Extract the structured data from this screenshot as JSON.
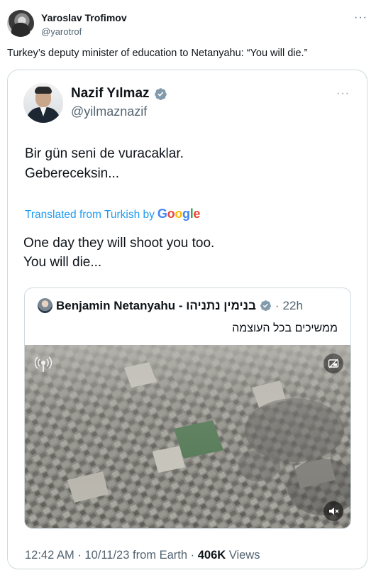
{
  "outer_tweet": {
    "author_name": "Yaroslav Trofimov",
    "author_handle": "@yarotrof",
    "more_label": "···",
    "text": "Turkey’s deputy minister of education to Netanyahu: “You will die.”"
  },
  "quoted_tweet": {
    "author_name": "Nazif Yılmaz",
    "author_handle": "@yilmaznazif",
    "more_label": "···",
    "original_text": "Bir gün seni de vuracaklar.\nGebereceksin...",
    "translated_label": "Translated from Turkish by",
    "translator": "Google",
    "translated_text": "One day they will shoot you too.\nYou will die...",
    "footer_time": "12:42 AM",
    "footer_date": "10/11/23",
    "footer_source": "from Earth",
    "footer_views_count": "406K",
    "footer_views_label": "Views",
    "footer_sep": "·"
  },
  "nested_tweet": {
    "author_name": "Benjamin Netanyahu - בנימין נתניהו",
    "time": "22h",
    "sep": "·",
    "text": "ממשיכים בכל העוצמה"
  },
  "colors": {
    "accent": "#1d9bf0",
    "secondary_text": "#536471",
    "border": "#cfd9de",
    "google_blue": "#4285F4",
    "google_red": "#EA4335",
    "google_yellow": "#FBBC05",
    "google_green": "#34A853"
  },
  "icons": {
    "verified": "verified-badge-icon",
    "live": "broadcast-icon",
    "pip": "picture-in-picture-icon",
    "mute": "volume-muted-icon"
  }
}
